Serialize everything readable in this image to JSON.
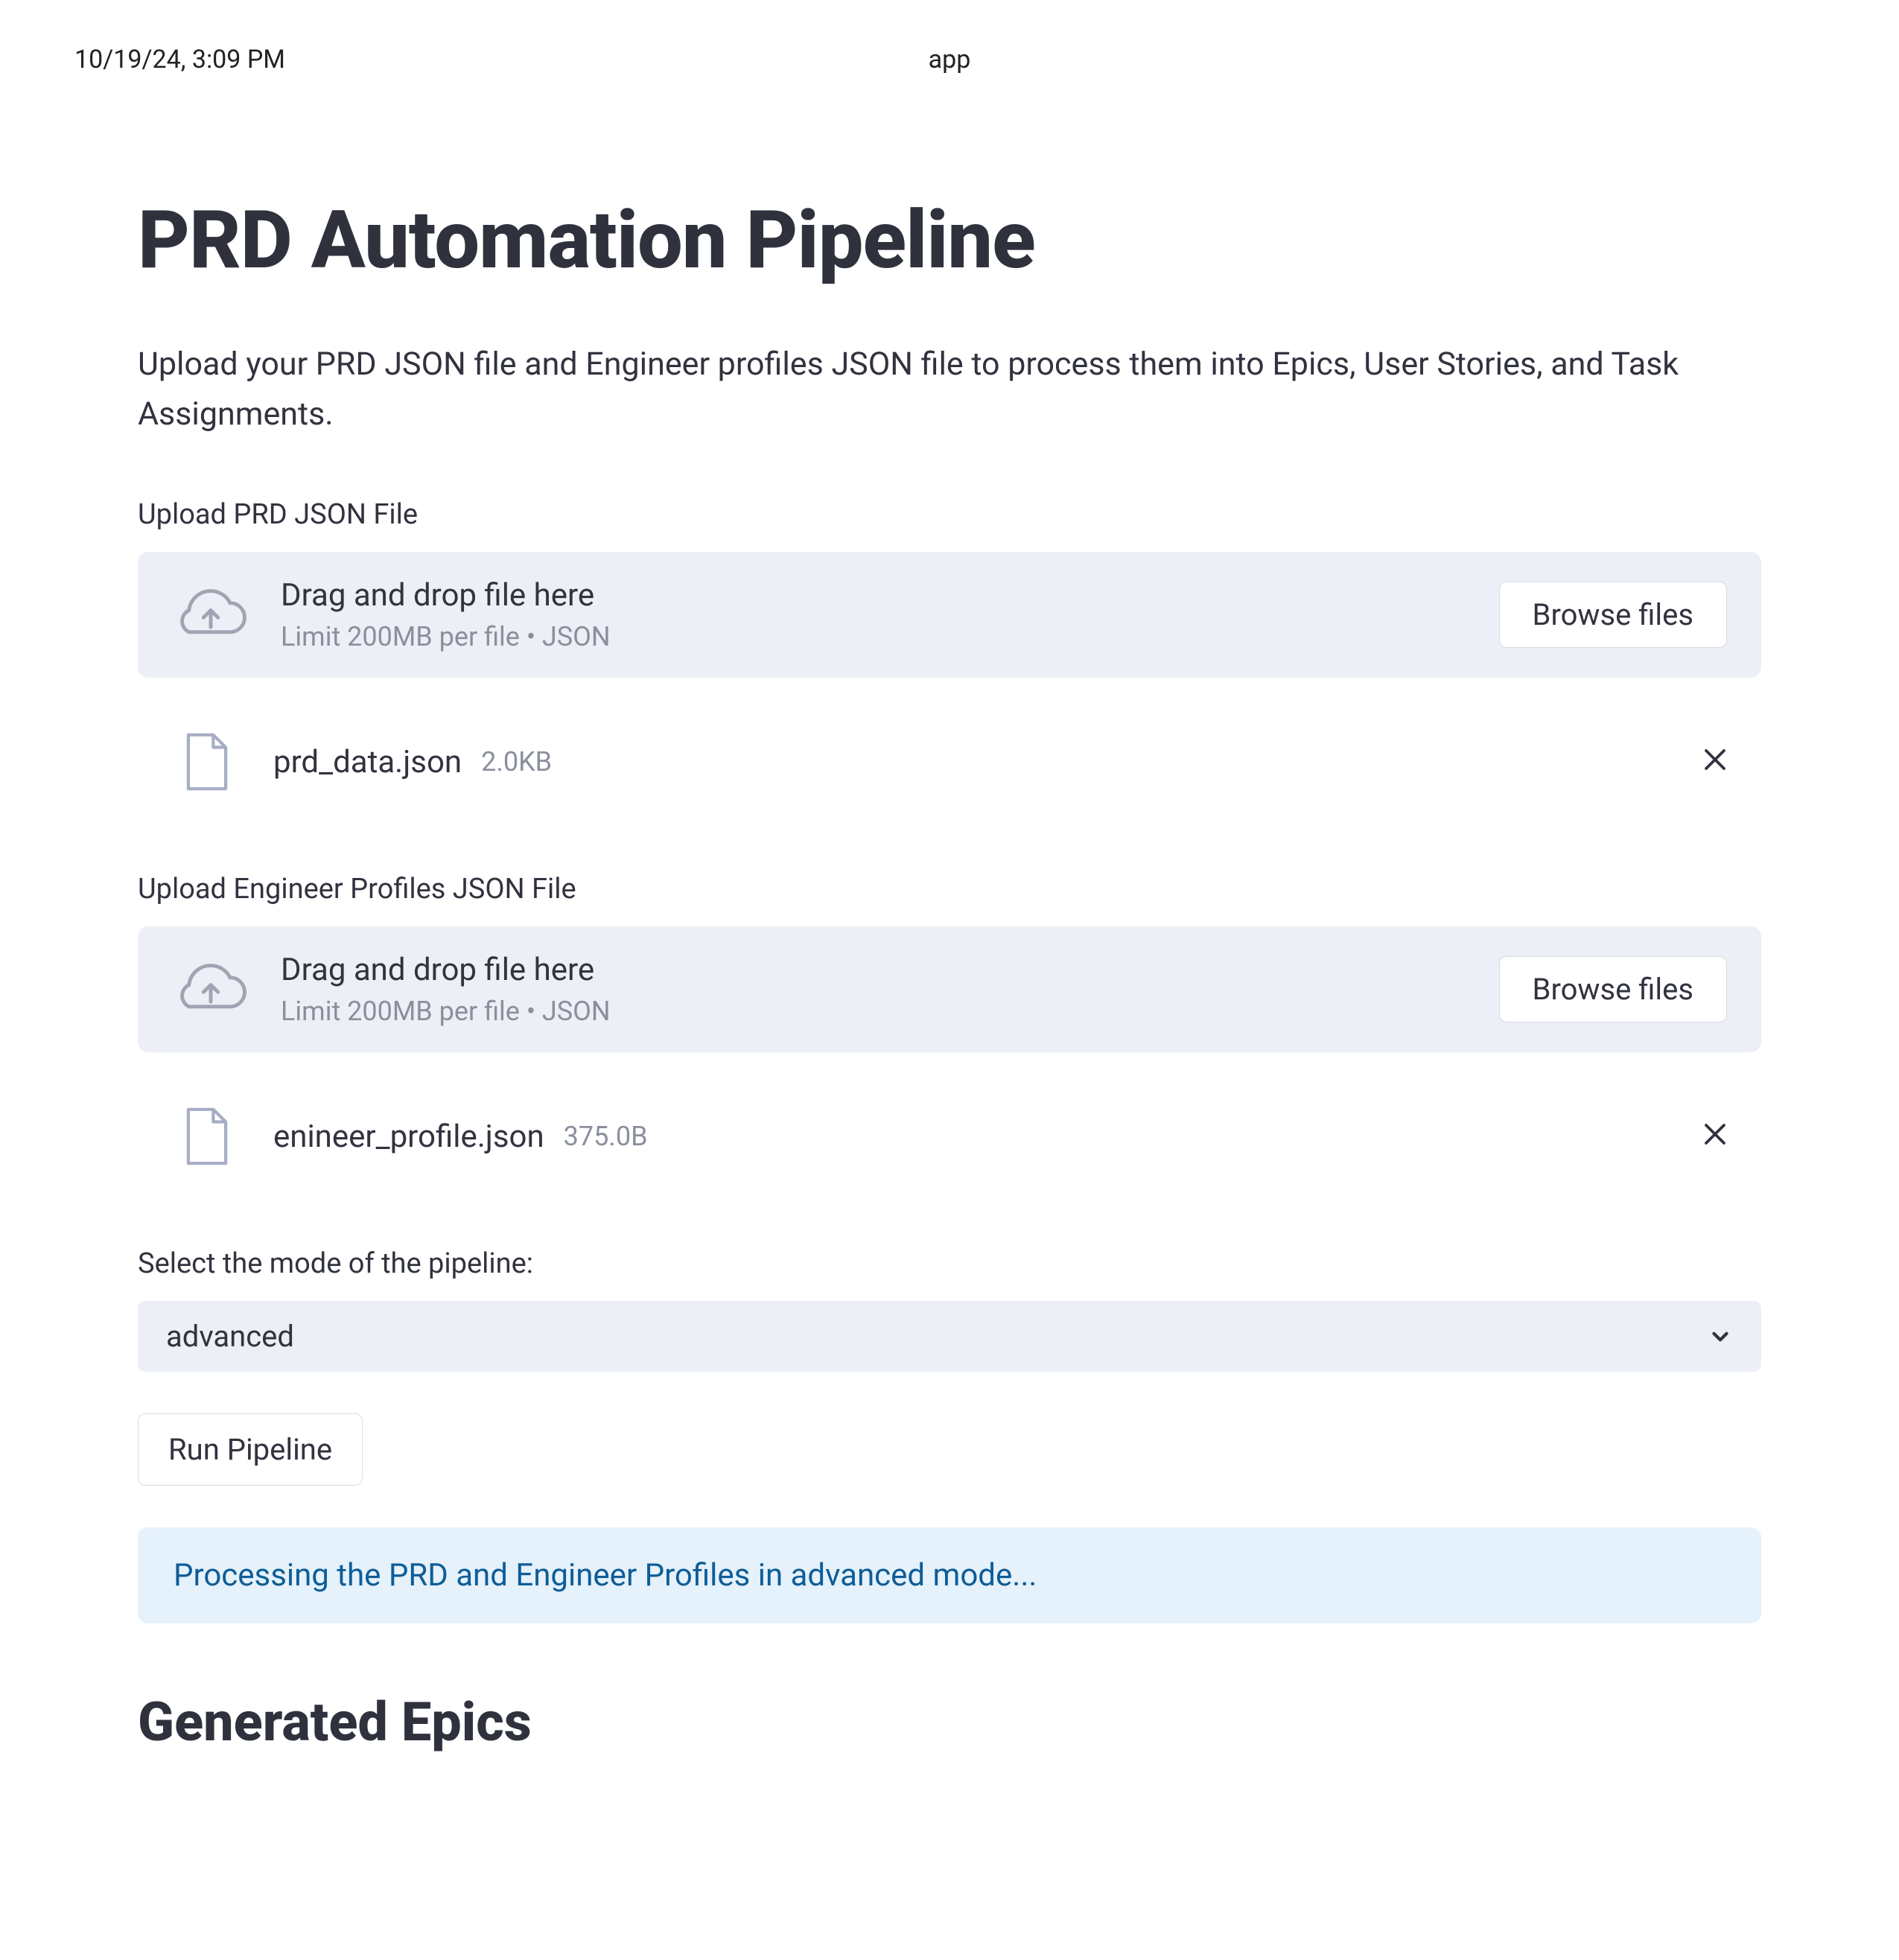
{
  "print_header": {
    "left": "10/19/24, 3:09 PM",
    "center": "app"
  },
  "page": {
    "title": "PRD Automation Pipeline",
    "subtitle": "Upload your PRD JSON file and Engineer profiles JSON file to process them into Epics, User Stories, and Task Assignments."
  },
  "uploads": [
    {
      "label": "Upload PRD JSON File",
      "dropzone_title": "Drag and drop file here",
      "dropzone_hint": "Limit 200MB per file • JSON",
      "browse_label": "Browse files",
      "file": {
        "name": "prd_data.json",
        "size": "2.0KB"
      }
    },
    {
      "label": "Upload Engineer Profiles JSON File",
      "dropzone_title": "Drag and drop file here",
      "dropzone_hint": "Limit 200MB per file • JSON",
      "browse_label": "Browse files",
      "file": {
        "name": "enineer_profile.json",
        "size": "375.0B"
      }
    }
  ],
  "mode": {
    "label": "Select the mode of the pipeline:",
    "value": "advanced"
  },
  "run_button": "Run Pipeline",
  "status_message": "Processing the PRD and Engineer Profiles in advanced mode...",
  "section_heading": "Generated Epics"
}
